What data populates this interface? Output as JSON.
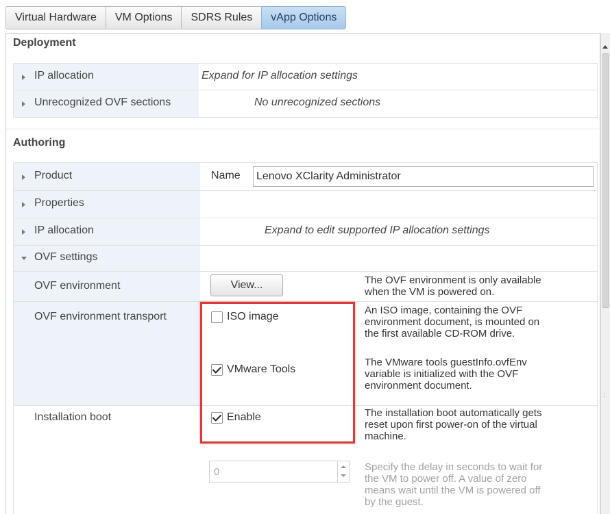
{
  "tabs": [
    {
      "label": "Virtual Hardware",
      "active": false
    },
    {
      "label": "VM Options",
      "active": false
    },
    {
      "label": "SDRS Rules",
      "active": false
    },
    {
      "label": "vApp Options",
      "active": true
    }
  ],
  "deployment": {
    "title": "Deployment",
    "ip_allocation": {
      "label": "IP allocation",
      "hint": "Expand for IP allocation settings"
    },
    "unrecognized": {
      "label": "Unrecognized OVF sections",
      "hint": "No unrecognized sections"
    }
  },
  "authoring": {
    "title": "Authoring",
    "product": {
      "label": "Product",
      "name_label": "Name",
      "name_value": "Lenovo XClarity Administrator"
    },
    "properties": {
      "label": "Properties"
    },
    "ip_allocation": {
      "label": "IP allocation",
      "hint": "Expand to edit supported IP allocation settings"
    },
    "ovf_settings": {
      "label": "OVF settings",
      "environment": {
        "label": "OVF environment",
        "button": "View...",
        "desc_line1": "The OVF environment is only available",
        "desc_line2": "when the VM is powered on."
      },
      "transport": {
        "label": "OVF environment transport",
        "iso": {
          "label": "ISO image",
          "checked": false,
          "desc_line1": "An ISO image, containing the OVF",
          "desc_line2": "environment document, is mounted on",
          "desc_line3": "the first available CD-ROM drive."
        },
        "vmware_tools": {
          "label": "VMware Tools",
          "checked": true,
          "desc_line1": "The VMware tools guestInfo.ovfEnv",
          "desc_line2": "variable is initialized with the OVF",
          "desc_line3": "environment document."
        }
      },
      "installation_boot": {
        "label": "Installation boot",
        "enable": {
          "label": "Enable",
          "checked": true
        },
        "desc_line1": "The installation boot automatically gets",
        "desc_line2": "reset upon first power-on of the virtual",
        "desc_line3": "machine.",
        "delay_value": "0",
        "delay_desc_line1": "Specify the delay in seconds to wait for",
        "delay_desc_line2": "the VM to power off. A value of zero",
        "delay_desc_line3": "means wait until the VM is powered off",
        "delay_desc_line4": "by the guest."
      }
    }
  },
  "colors": {
    "highlight": "#d93a3a",
    "active_tab": "#b8d3ef",
    "label_bg": "#eef3f9"
  }
}
